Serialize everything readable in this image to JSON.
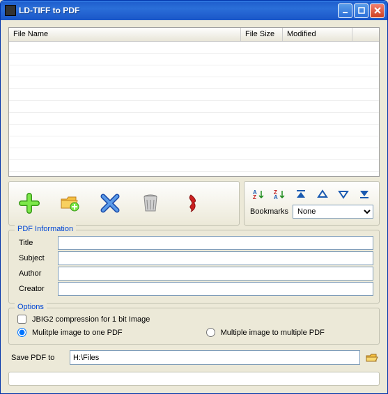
{
  "window": {
    "title": "LD-TIFF to PDF"
  },
  "table": {
    "columns": {
      "name": "File Name",
      "size": "File Size",
      "modified": "Modified"
    },
    "rows": []
  },
  "bookmarks": {
    "label": "Bookmarks",
    "selected": "None",
    "options": [
      "None"
    ]
  },
  "pdf_info": {
    "legend": "PDF Information",
    "labels": {
      "title": "Title",
      "subject": "Subject",
      "author": "Author",
      "creator": "Creator"
    },
    "values": {
      "title": "",
      "subject": "",
      "author": "",
      "creator": ""
    }
  },
  "options": {
    "legend": "Options",
    "jbig2": {
      "label": "JBIG2 compression for 1 bit Image",
      "checked": false
    },
    "multi_one": {
      "label": "Mulitple image to one PDF",
      "checked": true
    },
    "multi_multi": {
      "label": "Multiple image to multiple PDF",
      "checked": false
    }
  },
  "save": {
    "label": "Save PDF to",
    "path": "H:\\Files"
  }
}
